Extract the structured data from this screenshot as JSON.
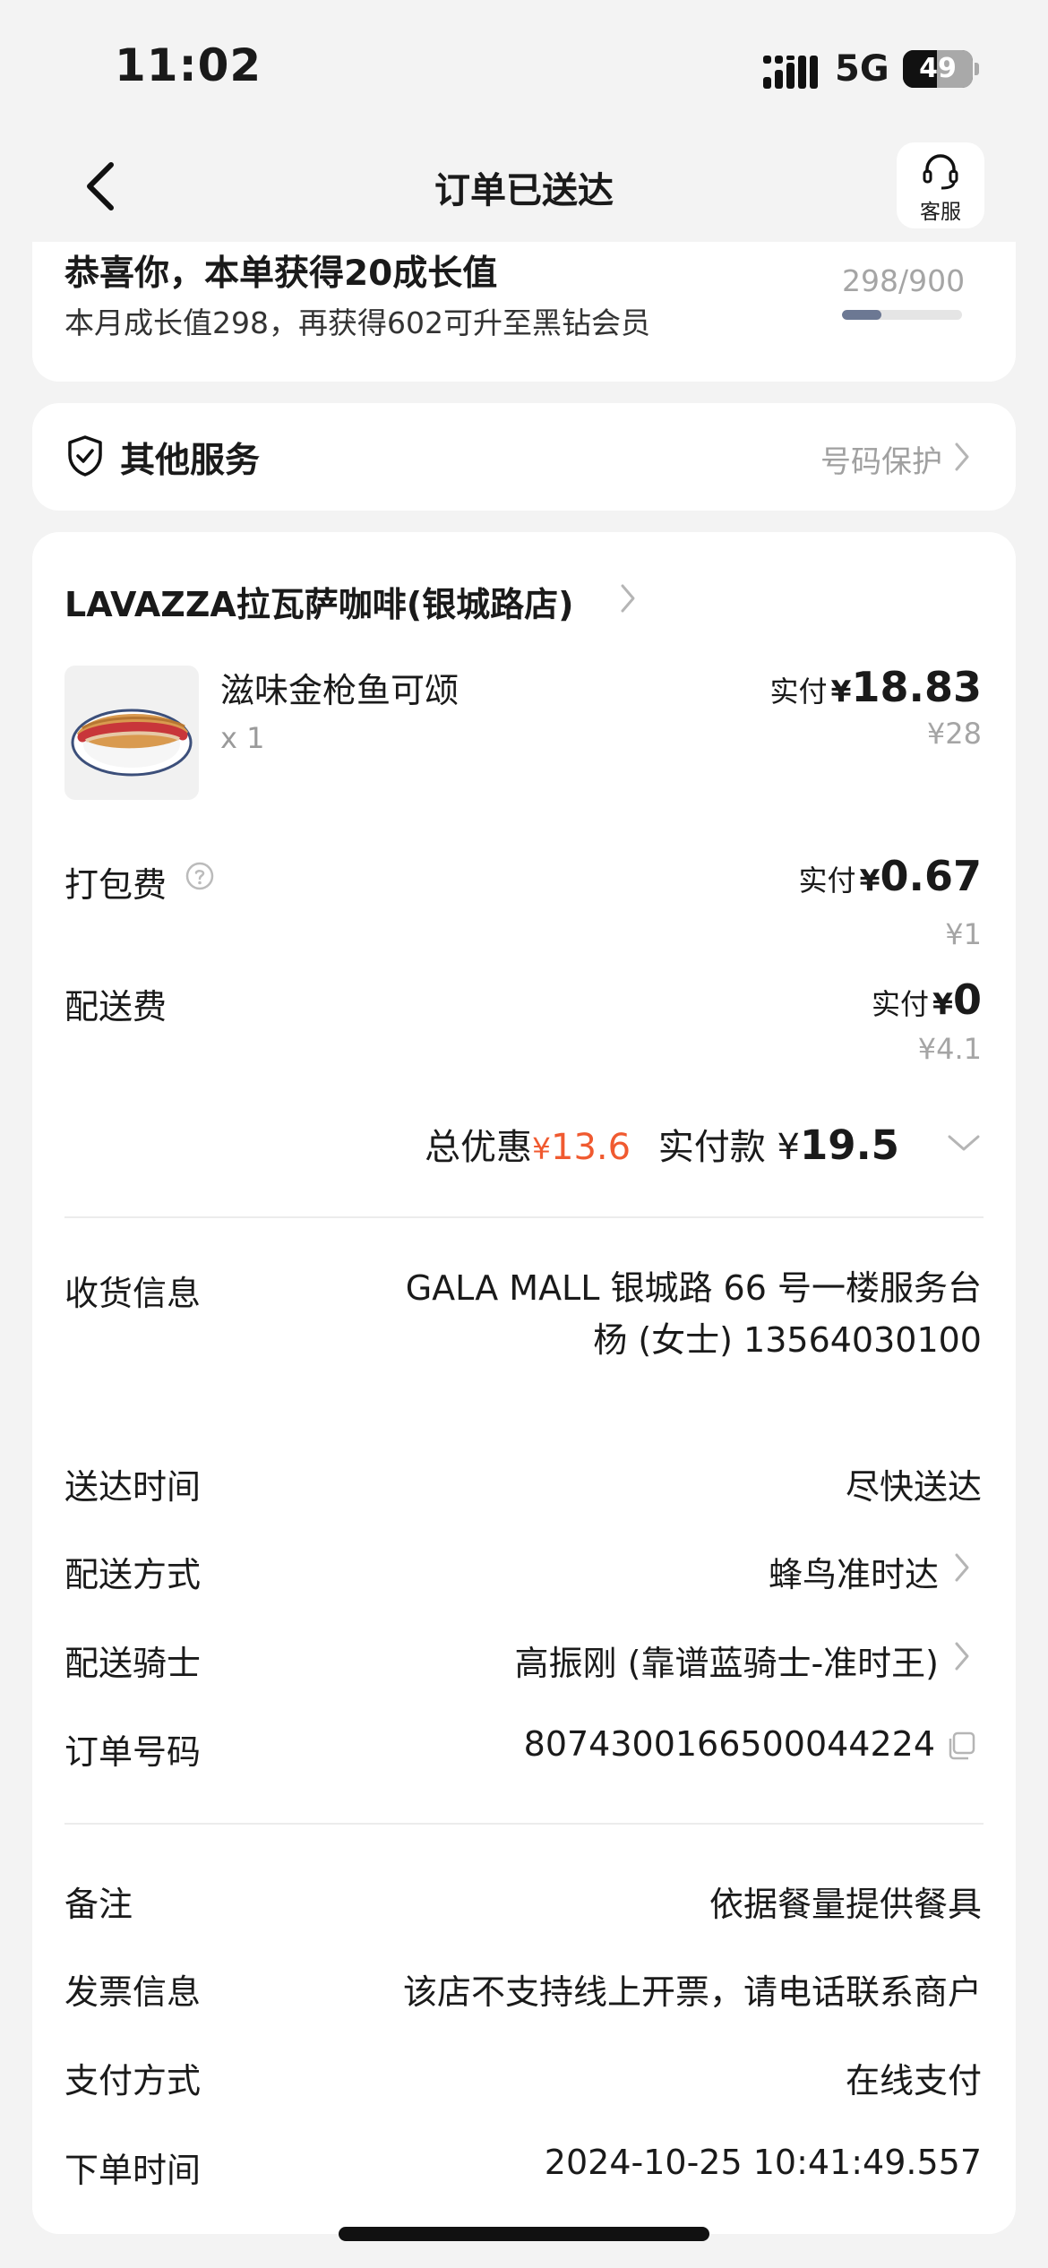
{
  "status_bar": {
    "time": "11:02",
    "network": "5G",
    "battery": "49",
    "battery_level": 0.49
  },
  "nav": {
    "title": "订单已送达",
    "service_label": "客服"
  },
  "growth": {
    "title": "恭喜你，本单获得20成长值",
    "subtitle": "本月成长值298，再获得602可升至黑钻会员",
    "progress_text": "298/900",
    "progress": 0.331
  },
  "services": {
    "title": "其他服务",
    "link": "号码保护"
  },
  "order": {
    "shop_name": "LAVAZZA拉瓦萨咖啡(银城路店)",
    "items": [
      {
        "name": "滋味金枪鱼可颂",
        "qty": "x 1",
        "paid_label": "实付",
        "currency": "¥",
        "paid": "18.83",
        "original": "¥28"
      }
    ],
    "fees": [
      {
        "label": "打包费",
        "paid_label": "实付",
        "currency": "¥",
        "paid": "0.67",
        "original": "¥1"
      },
      {
        "label": "配送费",
        "paid_label": "实付",
        "currency": "¥",
        "paid": "0",
        "original": "¥4.1"
      }
    ],
    "summary": {
      "discount_label": "总优惠",
      "discount_currency": "¥",
      "discount": "13.6",
      "total_label": "实付款",
      "total_currency": "¥",
      "total": "19.5"
    },
    "delivery_info": {
      "address_label": "收货信息",
      "address": "GALA MALL 银城路 66 号一楼服务台",
      "contact": "杨 (女士) 13564030100",
      "time_label": "送达时间",
      "time": "尽快送达",
      "method_label": "配送方式",
      "method": "蜂鸟准时达",
      "rider_label": "配送骑士",
      "rider": "高振刚 (靠谱蓝骑士-准时王)",
      "order_no_label": "订单号码",
      "order_no": "8074300166500044224"
    },
    "extra_info": {
      "note_label": "备注",
      "note": "依据餐量提供餐具",
      "invoice_label": "发票信息",
      "invoice": "该店不支持线上开票，请电话联系商户",
      "payment_label": "支付方式",
      "payment": "在线支付",
      "order_time_label": "下单时间",
      "order_time": "2024-10-25 10:41:49.557"
    }
  },
  "colors": {
    "accent_red": "#f05a30",
    "progress": "#6c7893",
    "background": "#f3f3f3"
  },
  "icons": [
    "signal-icon",
    "battery-icon",
    "back-arrow-icon",
    "headset-icon",
    "shield-check-icon",
    "chevron-right-icon",
    "help-circle-icon",
    "chevron-down-icon",
    "copy-icon"
  ]
}
